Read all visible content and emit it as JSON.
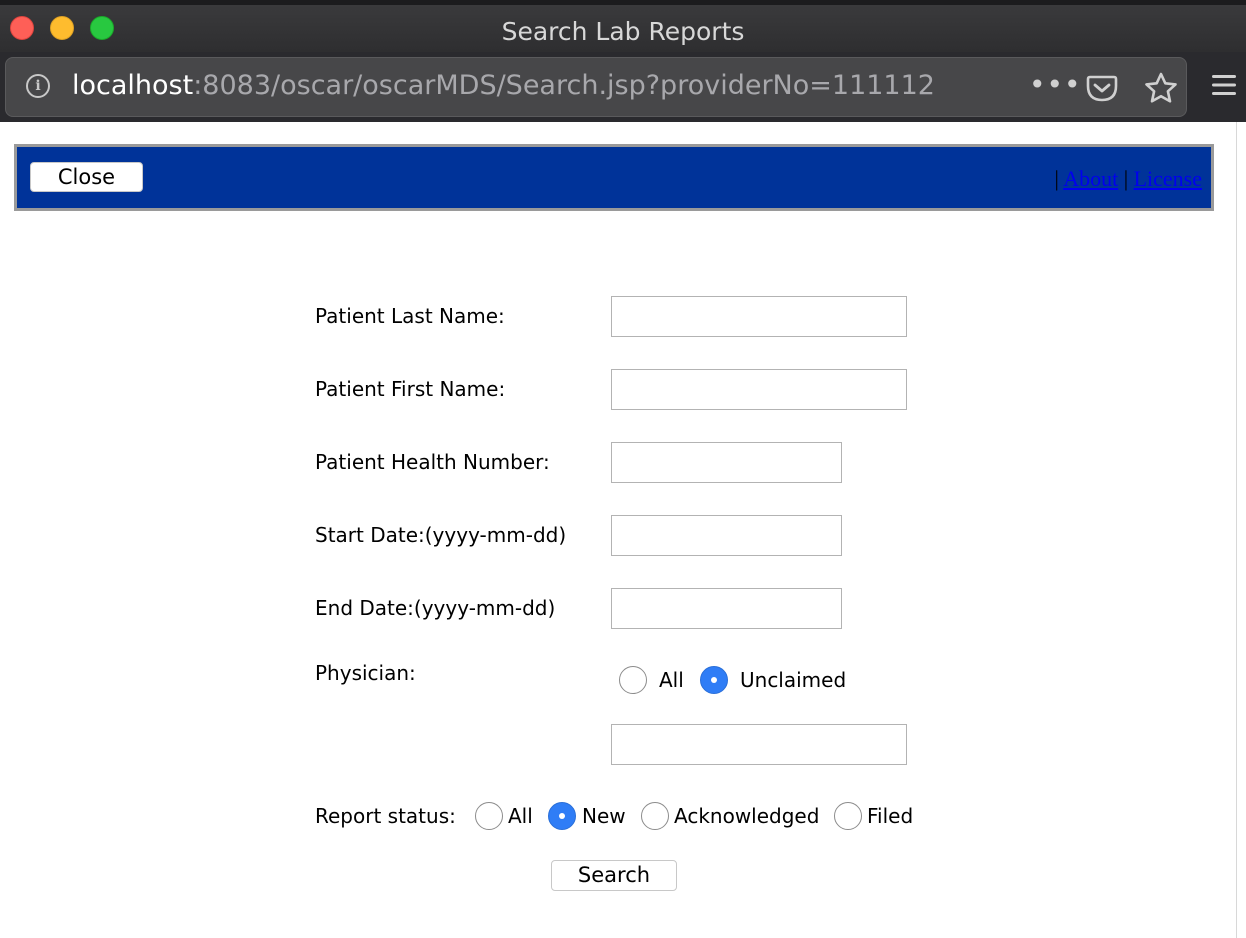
{
  "window": {
    "title": "Search Lab Reports"
  },
  "browser": {
    "url_host": "localhost",
    "url_path": ":8083/oscar/oscarMDS/Search.jsp?providerNo=111112",
    "more_label": "•••"
  },
  "header": {
    "close_label": "Close",
    "separator": "|",
    "about_label": "About",
    "license_label": "License"
  },
  "form": {
    "last_name_label": "Patient Last Name:",
    "last_name_value": "",
    "first_name_label": "Patient First Name:",
    "first_name_value": "",
    "health_number_label": "Patient Health Number:",
    "health_number_value": "",
    "start_date_label": "Start Date:(yyyy-mm-dd)",
    "start_date_value": "",
    "end_date_label": "End Date:(yyyy-mm-dd)",
    "end_date_value": "",
    "physician_label": "Physician:",
    "physician_options": [
      "All",
      "Unclaimed"
    ],
    "physician_selected": "Unclaimed",
    "physician_value": "",
    "report_status_label": "Report status:",
    "report_status_options": [
      "All",
      "New",
      "Acknowledged",
      "Filed"
    ],
    "report_status_selected": "New",
    "search_label": "Search"
  },
  "colors": {
    "header_bar": "#003399",
    "radio_checked": "#2f7df6",
    "link": "#0000ee"
  }
}
